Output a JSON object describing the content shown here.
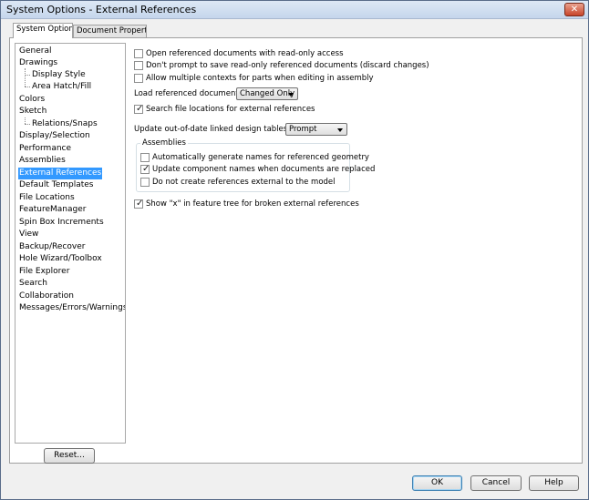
{
  "window": {
    "title": "System Options - External References",
    "close_icon": "close-icon"
  },
  "tabs": [
    {
      "label": "System Options",
      "active": true
    },
    {
      "label": "Document Properties",
      "active": false
    }
  ],
  "nav": {
    "items": [
      {
        "label": "General",
        "level": 0
      },
      {
        "label": "Drawings",
        "level": 0
      },
      {
        "label": "Display Style",
        "level": 1
      },
      {
        "label": "Area Hatch/Fill",
        "level": 1
      },
      {
        "label": "Colors",
        "level": 0
      },
      {
        "label": "Sketch",
        "level": 0
      },
      {
        "label": "Relations/Snaps",
        "level": 1
      },
      {
        "label": "Display/Selection",
        "level": 0
      },
      {
        "label": "Performance",
        "level": 0
      },
      {
        "label": "Assemblies",
        "level": 0
      },
      {
        "label": "External References",
        "level": 0,
        "selected": true
      },
      {
        "label": "Default Templates",
        "level": 0
      },
      {
        "label": "File Locations",
        "level": 0
      },
      {
        "label": "FeatureManager",
        "level": 0
      },
      {
        "label": "Spin Box Increments",
        "level": 0
      },
      {
        "label": "View",
        "level": 0
      },
      {
        "label": "Backup/Recover",
        "level": 0
      },
      {
        "label": "Hole Wizard/Toolbox",
        "level": 0
      },
      {
        "label": "File Explorer",
        "level": 0
      },
      {
        "label": "Search",
        "level": 0
      },
      {
        "label": "Collaboration",
        "level": 0
      },
      {
        "label": "Messages/Errors/Warnings",
        "level": 0
      }
    ],
    "reset_label": "Reset..."
  },
  "options": {
    "open_readonly": {
      "label": "Open referenced documents with read-only access",
      "checked": false
    },
    "dont_prompt_save": {
      "label": "Don't prompt to save read-only referenced documents (discard changes)",
      "checked": false
    },
    "multiple_contexts": {
      "label": "Allow multiple contexts for parts when editing in assembly",
      "checked": false
    },
    "load_referenced": {
      "label": "Load referenced documents:",
      "value": "Changed Only"
    },
    "search_file_locations": {
      "label": "Search file locations for external references",
      "checked": true
    },
    "update_design_tables": {
      "label": "Update out-of-date linked design tables to:",
      "value": "Prompt"
    },
    "assemblies_group": {
      "title": "Assemblies",
      "auto_generate_names": {
        "label": "Automatically generate names for referenced geometry",
        "checked": false
      },
      "update_component_names": {
        "label": "Update component names when documents are replaced",
        "checked": true
      },
      "no_external_refs": {
        "label": "Do not create references external to the model",
        "checked": false
      }
    },
    "show_x_broken": {
      "label": "Show \"x\" in feature tree for broken external references",
      "checked": true
    }
  },
  "check_glyph": "✓",
  "footer": {
    "ok_label": "OK",
    "cancel_label": "Cancel",
    "help_label": "Help"
  }
}
